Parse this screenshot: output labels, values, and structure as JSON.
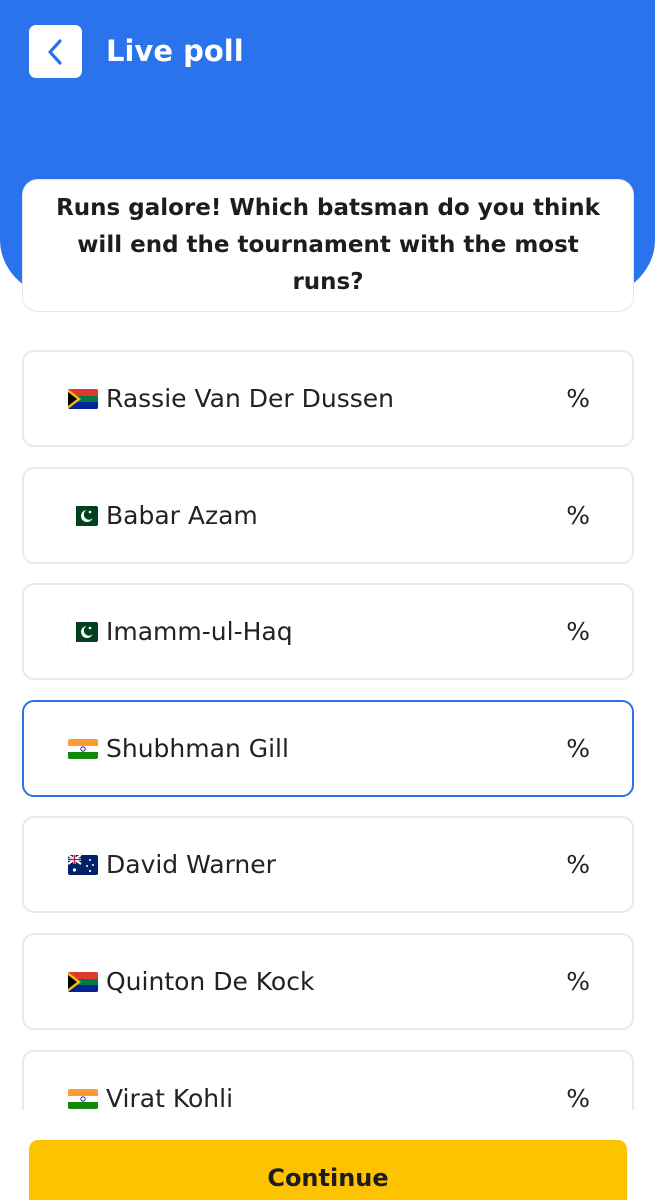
{
  "header": {
    "title": "Live poll",
    "back_icon": "chevron-left-icon",
    "background_color": "#2a73ec"
  },
  "question": {
    "text": "Runs galore! Which batsman do you think will end the tournament with the most runs?"
  },
  "options": [
    {
      "name": "Rassie Van Der Dussen",
      "flag": "south-africa-flag-icon",
      "percent": "%",
      "selected": false
    },
    {
      "name": "Babar Azam",
      "flag": "pakistan-flag-icon",
      "percent": "%",
      "selected": false
    },
    {
      "name": "Imamm-ul-Haq",
      "flag": "pakistan-flag-icon",
      "percent": "%",
      "selected": false
    },
    {
      "name": "Shubhman Gill",
      "flag": "india-flag-icon",
      "percent": "%",
      "selected": true
    },
    {
      "name": "David Warner",
      "flag": "australia-flag-icon",
      "percent": "%",
      "selected": false
    },
    {
      "name": "Quinton De Kock",
      "flag": "south-africa-flag-icon",
      "percent": "%",
      "selected": false
    },
    {
      "name": "Virat Kohli",
      "flag": "india-flag-icon",
      "percent": "%",
      "selected": false
    }
  ],
  "footer": {
    "continue_label": "Continue",
    "button_color": "#fdc300"
  },
  "colors": {
    "accent": "#2a73ec",
    "selected_border": "#2a73ec",
    "card_border": "#e8e9ec"
  }
}
